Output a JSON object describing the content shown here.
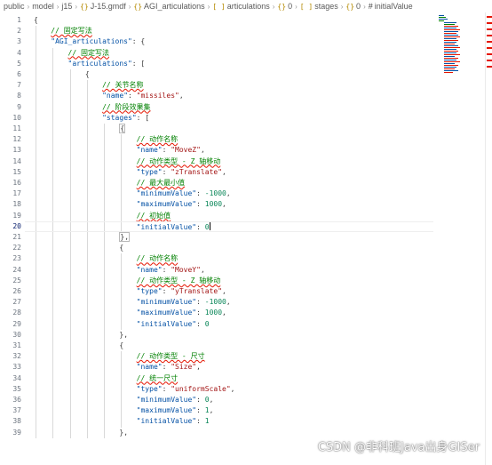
{
  "breadcrumb": {
    "segments": [
      {
        "label": "public",
        "icon": ""
      },
      {
        "label": "model",
        "icon": ""
      },
      {
        "label": "j15",
        "icon": ""
      },
      {
        "label": "J-15.gmdf",
        "icon": "{}"
      },
      {
        "label": "AGI_articulations",
        "icon": "{}"
      },
      {
        "label": "articulations",
        "icon": "[ ]"
      },
      {
        "label": "0",
        "icon": "{}"
      },
      {
        "label": "stages",
        "icon": "[ ]"
      },
      {
        "label": "0",
        "icon": "{}"
      },
      {
        "label": "initialValue",
        "icon": "#"
      }
    ]
  },
  "editor": {
    "active_line": 20,
    "line_numbers": [
      "1",
      "2",
      "3",
      "4",
      "5",
      "6",
      "7",
      "8",
      "9",
      "10",
      "11",
      "12",
      "13",
      "14",
      "15",
      "16",
      "17",
      "18",
      "19",
      "20",
      "21",
      "22",
      "23",
      "24",
      "25",
      "26",
      "27",
      "28",
      "29",
      "30",
      "31",
      "32",
      "33",
      "34",
      "35",
      "36",
      "37",
      "38",
      "39"
    ],
    "lines": [
      [
        {
          "t": "p",
          "v": "{"
        }
      ],
      [
        {
          "t": "c",
          "v": "// 固定写法"
        }
      ],
      [
        {
          "t": "k",
          "v": "\"AGI_articulations\""
        },
        {
          "t": "p",
          "v": ": {"
        }
      ],
      [
        {
          "t": "c",
          "v": "// 固定写法"
        }
      ],
      [
        {
          "t": "k",
          "v": "\"articulations\""
        },
        {
          "t": "p",
          "v": ": ["
        }
      ],
      [
        {
          "t": "p",
          "v": "{"
        }
      ],
      [
        {
          "t": "c",
          "v": "// 关节名称"
        }
      ],
      [
        {
          "t": "k",
          "v": "\"name\""
        },
        {
          "t": "p",
          "v": ": "
        },
        {
          "t": "s",
          "v": "\"missiles\""
        },
        {
          "t": "p",
          "v": ","
        }
      ],
      [
        {
          "t": "c",
          "v": "// 阶段效果集"
        }
      ],
      [
        {
          "t": "k",
          "v": "\"stages\""
        },
        {
          "t": "p",
          "v": ": ["
        }
      ],
      [
        {
          "t": "p",
          "v": "{"
        }
      ],
      [
        {
          "t": "c",
          "v": "// 动作名称"
        }
      ],
      [
        {
          "t": "k",
          "v": "\"name\""
        },
        {
          "t": "p",
          "v": ": "
        },
        {
          "t": "s",
          "v": "\"MoveZ\""
        },
        {
          "t": "p",
          "v": ","
        }
      ],
      [
        {
          "t": "c",
          "v": "// 动作类型 - Z 轴移动"
        }
      ],
      [
        {
          "t": "k",
          "v": "\"type\""
        },
        {
          "t": "p",
          "v": ": "
        },
        {
          "t": "s",
          "v": "\"zTranslate\""
        },
        {
          "t": "p",
          "v": ","
        }
      ],
      [
        {
          "t": "c",
          "v": "// 最大最小值"
        }
      ],
      [
        {
          "t": "k",
          "v": "\"minimumValue\""
        },
        {
          "t": "p",
          "v": ": "
        },
        {
          "t": "n",
          "v": "-1000"
        },
        {
          "t": "p",
          "v": ","
        }
      ],
      [
        {
          "t": "k",
          "v": "\"maximumValue\""
        },
        {
          "t": "p",
          "v": ": "
        },
        {
          "t": "n",
          "v": "1000"
        },
        {
          "t": "p",
          "v": ","
        }
      ],
      [
        {
          "t": "c",
          "v": "// 初始值"
        }
      ],
      [
        {
          "t": "k",
          "v": "\"initialValue\""
        },
        {
          "t": "p",
          "v": ": "
        },
        {
          "t": "n",
          "v": "0"
        }
      ],
      [
        {
          "t": "p",
          "v": "},"
        }
      ],
      [
        {
          "t": "p",
          "v": "{"
        }
      ],
      [
        {
          "t": "c",
          "v": "// 动作名称"
        }
      ],
      [
        {
          "t": "k",
          "v": "\"name\""
        },
        {
          "t": "p",
          "v": ": "
        },
        {
          "t": "s",
          "v": "\"MoveY\""
        },
        {
          "t": "p",
          "v": ","
        }
      ],
      [
        {
          "t": "c",
          "v": "// 动作类型 - Z 轴移动"
        }
      ],
      [
        {
          "t": "k",
          "v": "\"type\""
        },
        {
          "t": "p",
          "v": ": "
        },
        {
          "t": "s",
          "v": "\"yTranslate\""
        },
        {
          "t": "p",
          "v": ","
        }
      ],
      [
        {
          "t": "k",
          "v": "\"minimumValue\""
        },
        {
          "t": "p",
          "v": ": "
        },
        {
          "t": "n",
          "v": "-1000"
        },
        {
          "t": "p",
          "v": ","
        }
      ],
      [
        {
          "t": "k",
          "v": "\"maximumValue\""
        },
        {
          "t": "p",
          "v": ": "
        },
        {
          "t": "n",
          "v": "1000"
        },
        {
          "t": "p",
          "v": ","
        }
      ],
      [
        {
          "t": "k",
          "v": "\"initialValue\""
        },
        {
          "t": "p",
          "v": ": "
        },
        {
          "t": "n",
          "v": "0"
        }
      ],
      [
        {
          "t": "p",
          "v": "},"
        }
      ],
      [
        {
          "t": "p",
          "v": "{"
        }
      ],
      [
        {
          "t": "c",
          "v": "// 动作类型 - 尺寸"
        }
      ],
      [
        {
          "t": "k",
          "v": "\"name\""
        },
        {
          "t": "p",
          "v": ": "
        },
        {
          "t": "s",
          "v": "\"Size\""
        },
        {
          "t": "p",
          "v": ","
        }
      ],
      [
        {
          "t": "c",
          "v": "// 统一尺寸"
        }
      ],
      [
        {
          "t": "k",
          "v": "\"type\""
        },
        {
          "t": "p",
          "v": ": "
        },
        {
          "t": "s",
          "v": "\"uniformScale\""
        },
        {
          "t": "p",
          "v": ","
        }
      ],
      [
        {
          "t": "k",
          "v": "\"minimumValue\""
        },
        {
          "t": "p",
          "v": ": "
        },
        {
          "t": "n",
          "v": "0"
        },
        {
          "t": "p",
          "v": ","
        }
      ],
      [
        {
          "t": "k",
          "v": "\"maximumValue\""
        },
        {
          "t": "p",
          "v": ": "
        },
        {
          "t": "n",
          "v": "1"
        },
        {
          "t": "p",
          "v": ","
        }
      ],
      [
        {
          "t": "k",
          "v": "\"initialValue\""
        },
        {
          "t": "p",
          "v": ": "
        },
        {
          "t": "n",
          "v": "1"
        }
      ],
      [
        {
          "t": "p",
          "v": "},"
        }
      ]
    ]
  },
  "colors": {
    "key": "#0451a5",
    "string": "#a31515",
    "number": "#098658",
    "comment": "#008000",
    "squiggle": "#e51400"
  },
  "watermark": "CSDN @非科班Java出身GISer"
}
